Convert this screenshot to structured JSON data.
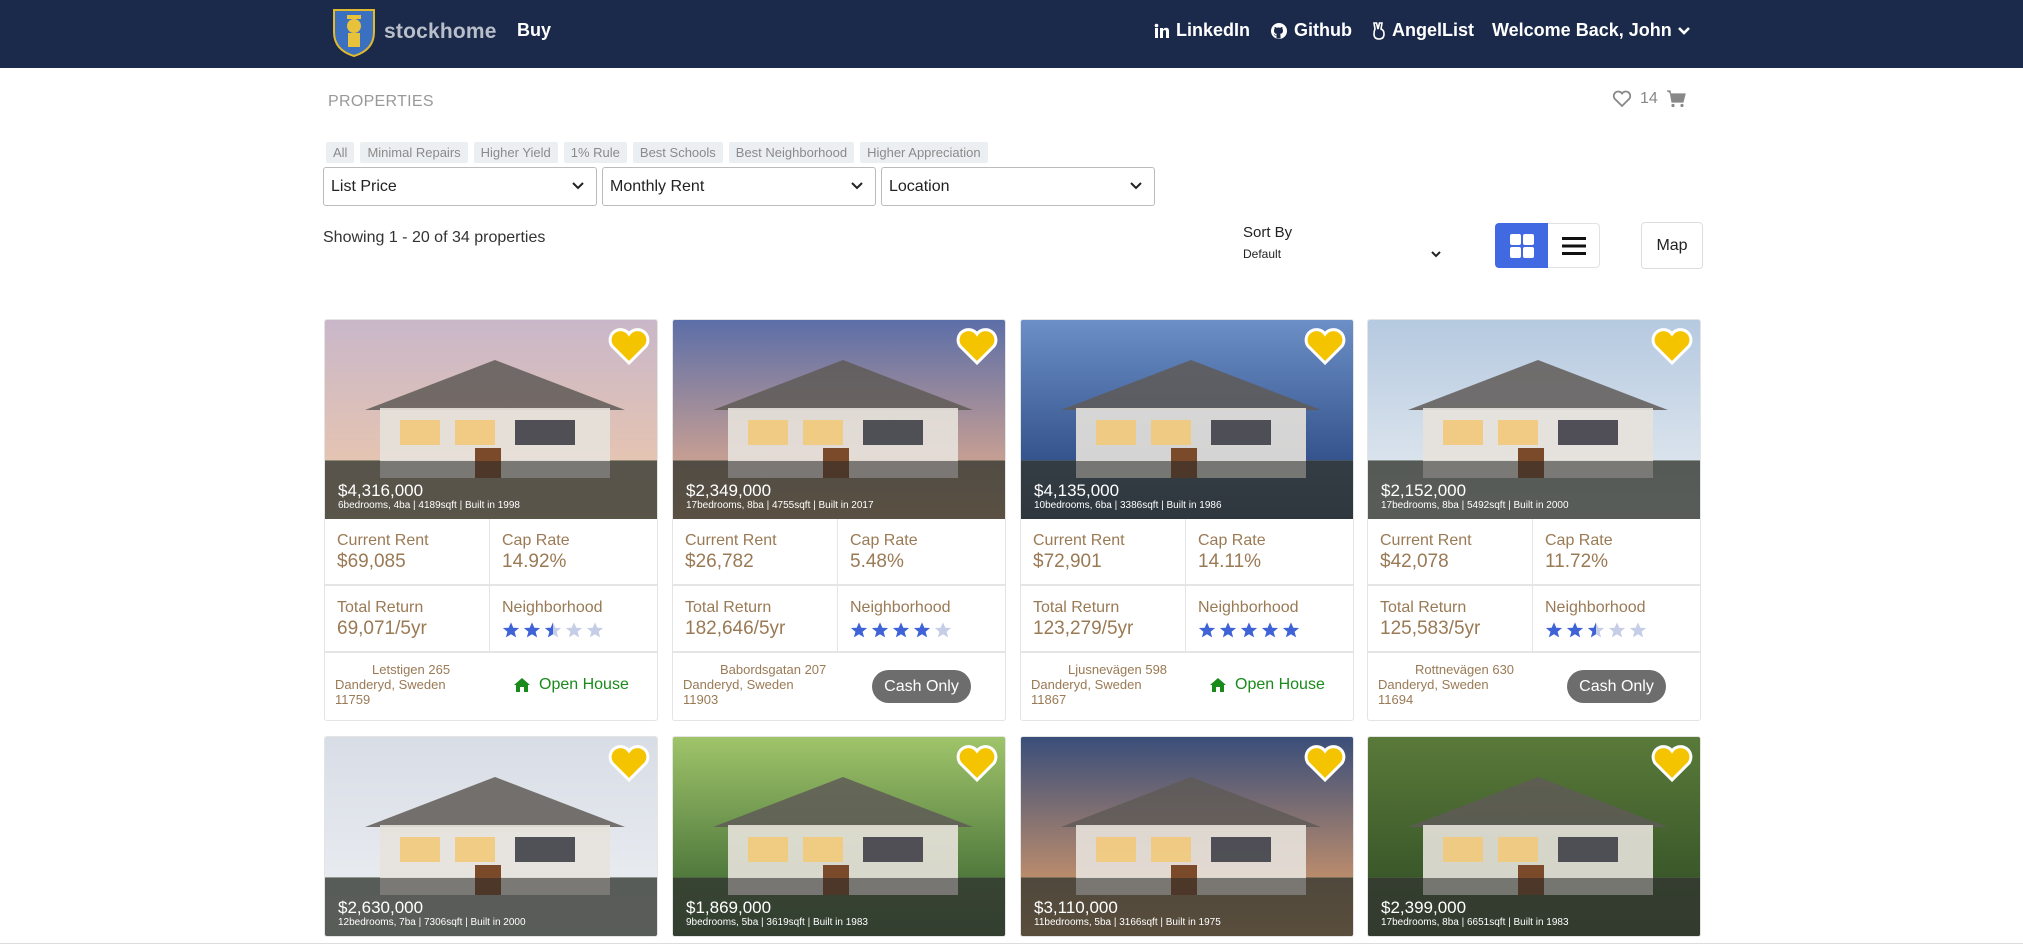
{
  "nav": {
    "brand": "stockhome",
    "buy": "Buy",
    "linkedin": "LinkedIn",
    "github": "Github",
    "angellist": "AngelList",
    "welcome": "Welcome Back, John"
  },
  "header": {
    "title": "PROPERTIES",
    "favorites_count": "14"
  },
  "filters": {
    "chips": [
      "All",
      "Minimal Repairs",
      "Higher Yield",
      "1% Rule",
      "Best Schools",
      "Best Neighborhood",
      "Higher Appreciation"
    ],
    "list_price": "List Price",
    "monthly_rent": "Monthly Rent",
    "location": "Location"
  },
  "results": {
    "showing": "Showing 1 - 20 of 34 properties",
    "sort_label": "Sort By",
    "sort_value": "Default",
    "map_label": "Map"
  },
  "labels": {
    "current_rent": "Current Rent",
    "cap_rate": "Cap Rate",
    "total_return": "Total Return",
    "neighborhood": "Neighborhood",
    "open_house": "Open House",
    "cash_only": "Cash Only"
  },
  "colors": {
    "navbar": "#1b2a4a",
    "accent": "#4169e1",
    "heart": "#f5c400",
    "stat_text": "#9a7a55",
    "open_house": "#1a8a1a"
  },
  "properties": [
    {
      "price": "$4,316,000",
      "specs": "6bedrooms, 4ba | 4189sqft | Built in 1998",
      "rent": "$69,085",
      "cap": "14.92%",
      "ret": "69,071/5yr",
      "stars": 2.5,
      "street": "Letstigen 265",
      "city": "Danderyd, Sweden",
      "zip": "11759",
      "tag": "open"
    },
    {
      "price": "$2,349,000",
      "specs": "17bedrooms, 8ba | 4755sqft | Built in 2017",
      "rent": "$26,782",
      "cap": "5.48%",
      "ret": "182,646/5yr",
      "stars": 4,
      "street": "Babordsgatan 207",
      "city": "Danderyd, Sweden",
      "zip": "11903",
      "tag": "cash"
    },
    {
      "price": "$4,135,000",
      "specs": "10bedrooms, 6ba | 3386sqft | Built in 1986",
      "rent": "$72,901",
      "cap": "14.11%",
      "ret": "123,279/5yr",
      "stars": 5,
      "street": "Ljusnevägen 598",
      "city": "Danderyd, Sweden",
      "zip": "11867",
      "tag": "open"
    },
    {
      "price": "$2,152,000",
      "specs": "17bedrooms, 8ba | 5492sqft | Built in 2000",
      "rent": "$42,078",
      "cap": "11.72%",
      "ret": "125,583/5yr",
      "stars": 2.5,
      "street": "Rottnevägen 630",
      "city": "Danderyd, Sweden",
      "zip": "11694",
      "tag": "cash"
    },
    {
      "price": "$2,630,000",
      "specs": "12bedrooms, 7ba | 7306sqft | Built in 2000"
    },
    {
      "price": "$1,869,000",
      "specs": "9bedrooms, 5ba | 3619sqft | Built in 1983"
    },
    {
      "price": "$3,110,000",
      "specs": "11bedrooms, 5ba | 3166sqft | Built in 1975"
    },
    {
      "price": "$2,399,000",
      "specs": "17bedrooms, 8ba | 6651sqft | Built in 1983"
    }
  ]
}
